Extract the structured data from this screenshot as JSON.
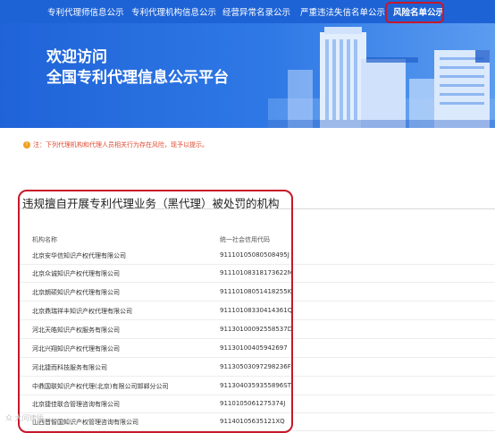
{
  "nav": {
    "items": [
      {
        "label": "专利代理师信息公示"
      },
      {
        "label": "专利代理机构信息公示"
      },
      {
        "label": "经营异常名录公示"
      },
      {
        "label": "严重违法失信名单公示"
      },
      {
        "label": "风险名单公示"
      }
    ],
    "active_index": 4
  },
  "hero": {
    "title_line1": "欢迎访问",
    "title_line2": "全国专利代理信息公示平台"
  },
  "notice": {
    "icon": "warning-icon",
    "text": "注：下列代理机构和代理人员相关行为存在风险，现予以提示。"
  },
  "section": {
    "title": "违规擅自开展专利代理业务（黑代理）被处罚的机构"
  },
  "table": {
    "headers": [
      "机构名称",
      "统一社会信用代码"
    ],
    "rows": [
      {
        "name": "北京安华信知识产权代理有限公司",
        "code": "91110105080508495J"
      },
      {
        "name": "北京众诚知识产权代理有限公司",
        "code": "91110108318173622M"
      },
      {
        "name": "北京朗硕知识产权代理有限公司",
        "code": "91110108051418255K"
      },
      {
        "name": "北京鼎瑞祥丰知识产权代理有限公司",
        "code": "91110108330414361Q"
      },
      {
        "name": "河北天皓知识产权服务有限公司",
        "code": "91130100092558537D"
      },
      {
        "name": "河北兴翔知识产权代理有限公司",
        "code": "91130100405942697"
      },
      {
        "name": "河北捷而科技服务有限公司",
        "code": "91130503097298236F"
      },
      {
        "name": "中鼎国联知识产权代理(北京)有限公司邯郸分公司",
        "code": "9113040359355896ST"
      },
      {
        "name": "北京捷佳联合管理咨询有限公司",
        "code": "9110105061275374J"
      },
      {
        "name": "山西晋智国知识产权管理咨询有限公司",
        "code": "91140105635121XQ"
      }
    ]
  },
  "watermark": "众 大问律师",
  "colors": {
    "nav_bg": "#1e63d6",
    "highlight": "#c8182a",
    "notice": "#e0492f"
  }
}
